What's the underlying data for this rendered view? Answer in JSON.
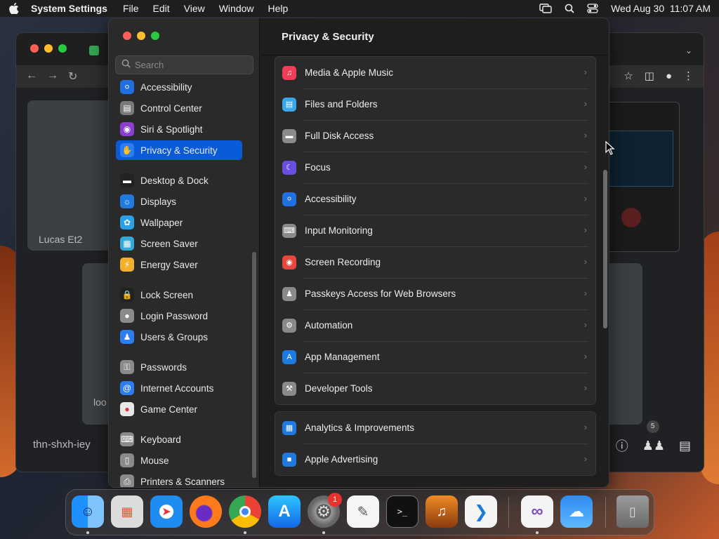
{
  "menubar": {
    "app_name": "System Settings",
    "menus": [
      "File",
      "Edit",
      "View",
      "Window",
      "Help"
    ],
    "datetime": "Wed Aug 30  11:07 AM"
  },
  "chrome_window": {
    "participants": [
      {
        "label": "Lucas Et2"
      },
      {
        "label": "loo"
      }
    ],
    "meeting_code": "thn-shxh-iey",
    "people_count": "5"
  },
  "settings": {
    "search_placeholder": "Search",
    "title": "Privacy & Security",
    "sidebar_items": [
      {
        "label": "Accessibility",
        "icon": "accessibility-icon",
        "color": "#1f6fe0"
      },
      {
        "label": "Control Center",
        "icon": "control-center-icon",
        "color": "#7a7a7a"
      },
      {
        "label": "Siri & Spotlight",
        "icon": "siri-icon",
        "color": "#8a3fd1"
      },
      {
        "label": "Privacy & Security",
        "icon": "hand-icon",
        "color": "#2d7cf0"
      },
      {
        "label": "Desktop & Dock",
        "icon": "desktop-dock-icon",
        "color": "#222222"
      },
      {
        "label": "Displays",
        "icon": "displays-icon",
        "color": "#1f7ae0"
      },
      {
        "label": "Wallpaper",
        "icon": "wallpaper-icon",
        "color": "#2aa0e8"
      },
      {
        "label": "Screen Saver",
        "icon": "screen-saver-icon",
        "color": "#34a8d9"
      },
      {
        "label": "Energy Saver",
        "icon": "battery-icon",
        "color": "#f2b12d"
      },
      {
        "label": "Lock Screen",
        "icon": "lock-icon",
        "color": "#222222"
      },
      {
        "label": "Login Password",
        "icon": "login-password-icon",
        "color": "#8a8a8a"
      },
      {
        "label": "Users & Groups",
        "icon": "users-icon",
        "color": "#2d7cf0"
      },
      {
        "label": "Passwords",
        "icon": "key-icon",
        "color": "#8a8a8a"
      },
      {
        "label": "Internet Accounts",
        "icon": "at-icon",
        "color": "#2d7cf0"
      },
      {
        "label": "Game Center",
        "icon": "game-center-icon",
        "color": "#e8e8e8"
      },
      {
        "label": "Keyboard",
        "icon": "keyboard-icon",
        "color": "#8a8a8a"
      },
      {
        "label": "Mouse",
        "icon": "mouse-icon",
        "color": "#8a8a8a"
      },
      {
        "label": "Printers & Scanners",
        "icon": "printer-icon",
        "color": "#8a8a8a"
      }
    ],
    "privacy_rows": [
      {
        "label": "Media & Apple Music",
        "icon": "music-note-icon",
        "color": "#f23d58"
      },
      {
        "label": "Files and Folders",
        "icon": "folder-icon",
        "color": "#3aa8e8"
      },
      {
        "label": "Full Disk Access",
        "icon": "disk-icon",
        "color": "#8a8a8a"
      },
      {
        "label": "Focus",
        "icon": "moon-icon",
        "color": "#6a4ee0"
      },
      {
        "label": "Accessibility",
        "icon": "accessibility-icon",
        "color": "#1f6fe0"
      },
      {
        "label": "Input Monitoring",
        "icon": "keyboard-icon",
        "color": "#8a8a8a"
      },
      {
        "label": "Screen Recording",
        "icon": "record-icon",
        "color": "#e8453c"
      },
      {
        "label": "Passkeys Access for Web Browsers",
        "icon": "passkey-icon",
        "color": "#8a8a8a"
      },
      {
        "label": "Automation",
        "icon": "gears-icon",
        "color": "#8a8a8a"
      },
      {
        "label": "App Management",
        "icon": "app-store-icon",
        "color": "#1f7ae0"
      },
      {
        "label": "Developer Tools",
        "icon": "hammer-icon",
        "color": "#8a8a8a"
      }
    ],
    "analytics_rows": [
      {
        "label": "Analytics & Improvements",
        "icon": "bar-chart-icon",
        "color": "#1f7ae0"
      },
      {
        "label": "Apple Advertising",
        "icon": "megaphone-icon",
        "color": "#1f7ae0"
      }
    ]
  },
  "dock": {
    "apps": [
      {
        "name": "Finder",
        "icon": "finder-icon"
      },
      {
        "name": "Launchpad",
        "icon": "launchpad-icon"
      },
      {
        "name": "Safari",
        "icon": "safari-icon"
      },
      {
        "name": "Firefox",
        "icon": "firefox-icon"
      },
      {
        "name": "Chrome",
        "icon": "chrome-icon"
      },
      {
        "name": "App Store",
        "icon": "app-store-icon"
      },
      {
        "name": "System Settings",
        "icon": "system-settings-icon"
      },
      {
        "name": "TextEdit",
        "icon": "textedit-icon"
      },
      {
        "name": "Terminal",
        "icon": "terminal-icon"
      },
      {
        "name": "GarageBand",
        "icon": "guitar-icon"
      },
      {
        "name": "Visual Studio Code",
        "icon": "vscode-icon"
      },
      {
        "name": "Visual Studio",
        "icon": "visual-studio-icon"
      },
      {
        "name": "Weather",
        "icon": "weather-icon"
      },
      {
        "name": "Trash",
        "icon": "trash-icon"
      }
    ],
    "settings_badge": "1"
  }
}
